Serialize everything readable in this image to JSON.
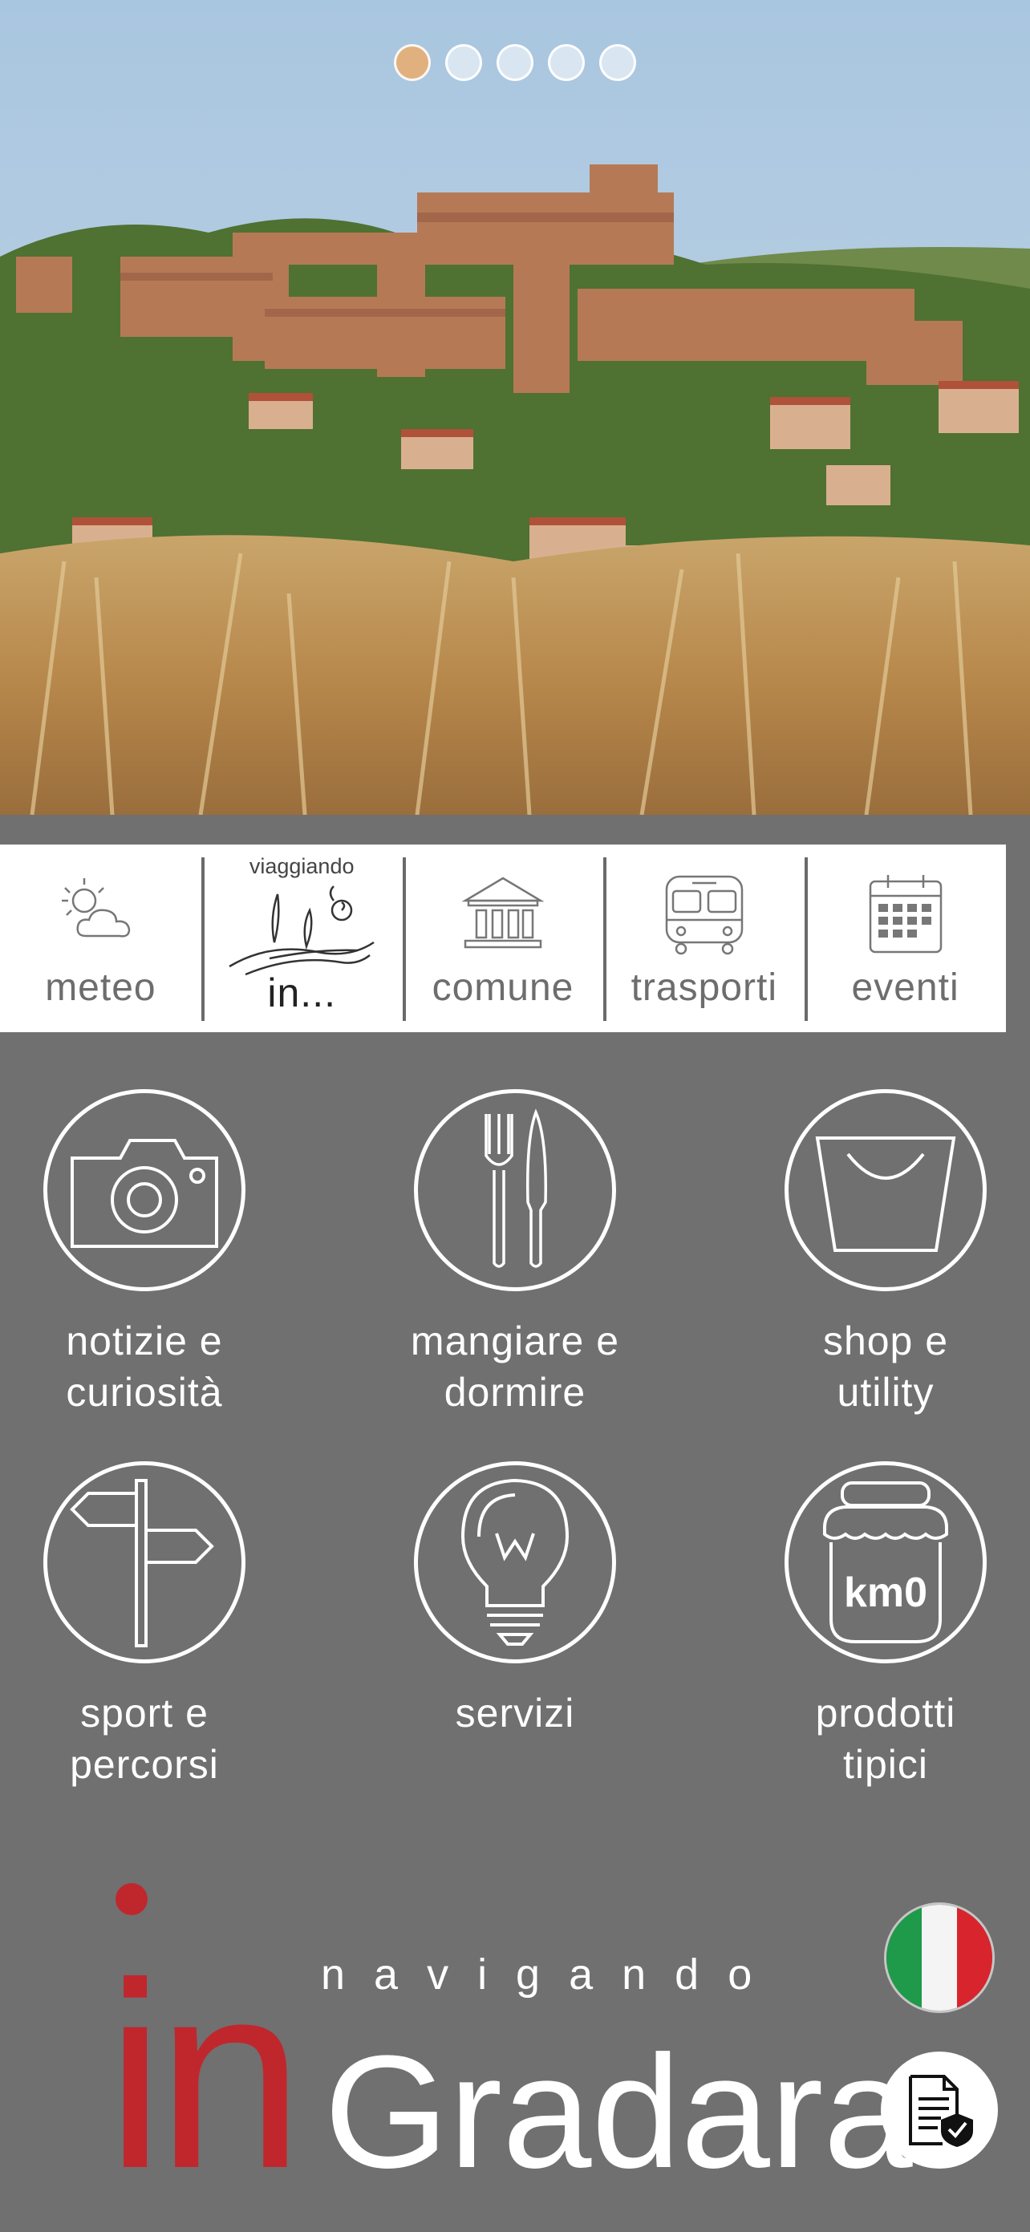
{
  "carousel": {
    "total": 5,
    "active_index": 0
  },
  "quick_bar": {
    "items": [
      {
        "label": "meteo",
        "icon": "weather-icon"
      },
      {
        "label": "in...",
        "top_label": "viaggiando",
        "icon": "viaggiando-logo-icon"
      },
      {
        "label": "comune",
        "icon": "town-hall-icon"
      },
      {
        "label": "trasporti",
        "icon": "bus-icon"
      },
      {
        "label": "eventi",
        "icon": "calendar-icon"
      }
    ]
  },
  "tiles": [
    {
      "line1": "notizie e",
      "line2": "curiosità",
      "icon": "camera-icon"
    },
    {
      "line1": "mangiare e",
      "line2": "dormire",
      "icon": "cutlery-icon"
    },
    {
      "line1": "shop e",
      "line2": "utility",
      "icon": "shopping-bag-icon"
    },
    {
      "line1": "sport e",
      "line2": "percorsi",
      "icon": "signpost-icon"
    },
    {
      "line1": "servizi",
      "line2": "",
      "icon": "lightbulb-icon"
    },
    {
      "line1": "prodotti",
      "line2": "tipici",
      "icon": "jar-icon",
      "jar_text": "km0"
    }
  ],
  "brand": {
    "prefix": "in",
    "tagline": "navigando",
    "name": "Gradara",
    "prefix_color": "#c0272d"
  },
  "colors": {
    "background": "#707070",
    "accent_dot": "#e0b07e",
    "flag_green": "#1e9a4a",
    "flag_white": "#f4f4f4",
    "flag_red": "#d8252d"
  },
  "actions": {
    "language_icon": "italian-flag-icon",
    "document_icon": "document-check-icon"
  }
}
